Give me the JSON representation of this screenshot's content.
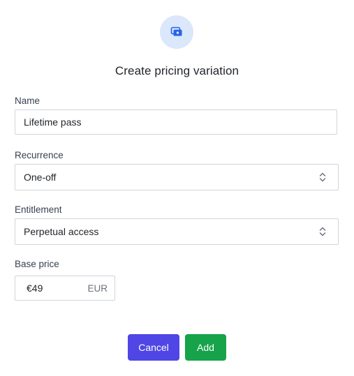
{
  "dialog": {
    "title": "Create pricing variation",
    "icon": "money-icon",
    "accent": "#2563eb"
  },
  "fields": {
    "name": {
      "label": "Name",
      "value": "Lifetime pass"
    },
    "recurrence": {
      "label": "Recurrence",
      "value": "One-off"
    },
    "entitlement": {
      "label": "Entitlement",
      "value": "Perpetual access"
    },
    "base_price": {
      "label": "Base price",
      "value": "€49",
      "currency": "EUR"
    }
  },
  "actions": {
    "cancel_label": "Cancel",
    "cancel_color": "#4f46e5",
    "add_label": "Add",
    "add_color": "#16a34a"
  }
}
